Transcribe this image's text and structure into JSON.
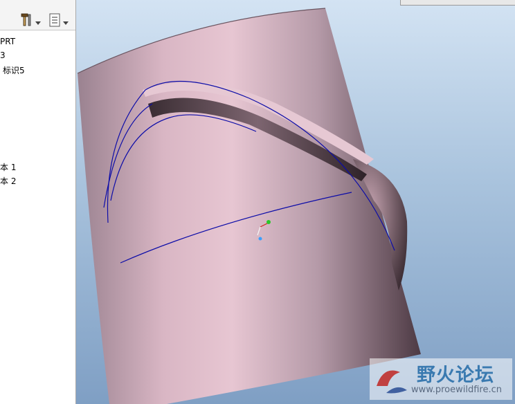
{
  "model_tree": {
    "items": [
      "PRT",
      "3",
      "标识5",
      "本 1",
      "本 2"
    ]
  },
  "watermark": {
    "title": "野火论坛",
    "url": "www.proewildfire.cn"
  },
  "colors": {
    "viewport_top": "#d3e3f3",
    "viewport_bottom": "#7f9fc4",
    "model_surface": "#c9a7b4",
    "curve_blue": "#0c0ca8"
  },
  "icons": {
    "tool_icon": "tools-icon",
    "list_icon": "settings-list-icon"
  }
}
